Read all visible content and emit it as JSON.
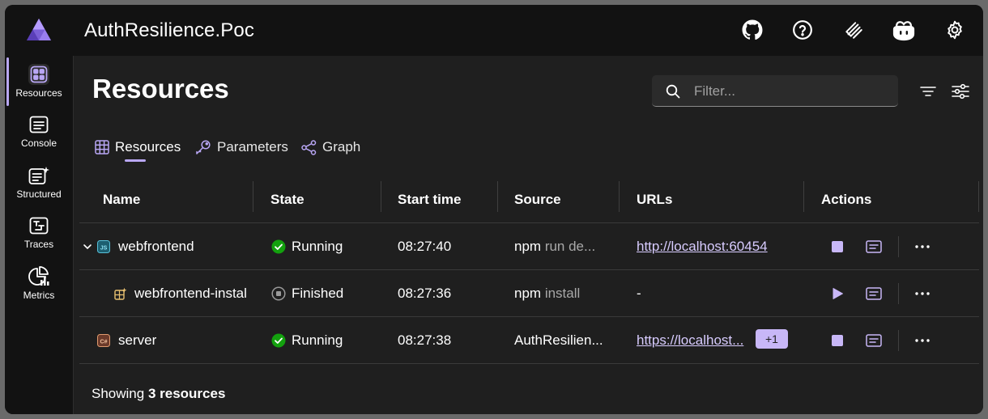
{
  "app": {
    "title": "AuthResilience.Poc"
  },
  "sidebar": {
    "items": [
      {
        "label": "Resources",
        "active": true
      },
      {
        "label": "Console"
      },
      {
        "label": "Structured"
      },
      {
        "label": "Traces"
      },
      {
        "label": "Metrics"
      }
    ]
  },
  "page": {
    "title": "Resources",
    "filter_placeholder": "Filter...",
    "tabs": [
      {
        "label": "Resources",
        "active": true
      },
      {
        "label": "Parameters"
      },
      {
        "label": "Graph"
      }
    ]
  },
  "table": {
    "columns": [
      "Name",
      "State",
      "Start time",
      "Source",
      "URLs",
      "Actions"
    ],
    "rows": [
      {
        "name": "webfrontend",
        "state": "Running",
        "start_time": "08:27:40",
        "source_cmd": "npm",
        "source_args": "run de...",
        "url": "http://localhost:60454",
        "extra": ""
      },
      {
        "name": "webfrontend-instal",
        "state": "Finished",
        "start_time": "08:27:36",
        "source_cmd": "npm",
        "source_args": "install",
        "url": "-",
        "extra": ""
      },
      {
        "name": "server",
        "state": "Running",
        "start_time": "08:27:38",
        "source_cmd": "AuthResilien...",
        "source_args": "",
        "url": "https://localhost...",
        "extra": "+1"
      }
    ]
  },
  "footer": {
    "prefix": "Showing",
    "count": "3 resources"
  },
  "colors": {
    "accent": "#b9a7f5",
    "running": "#13a10e",
    "link": "#d8ccff",
    "badge": "#c8b7f7"
  }
}
